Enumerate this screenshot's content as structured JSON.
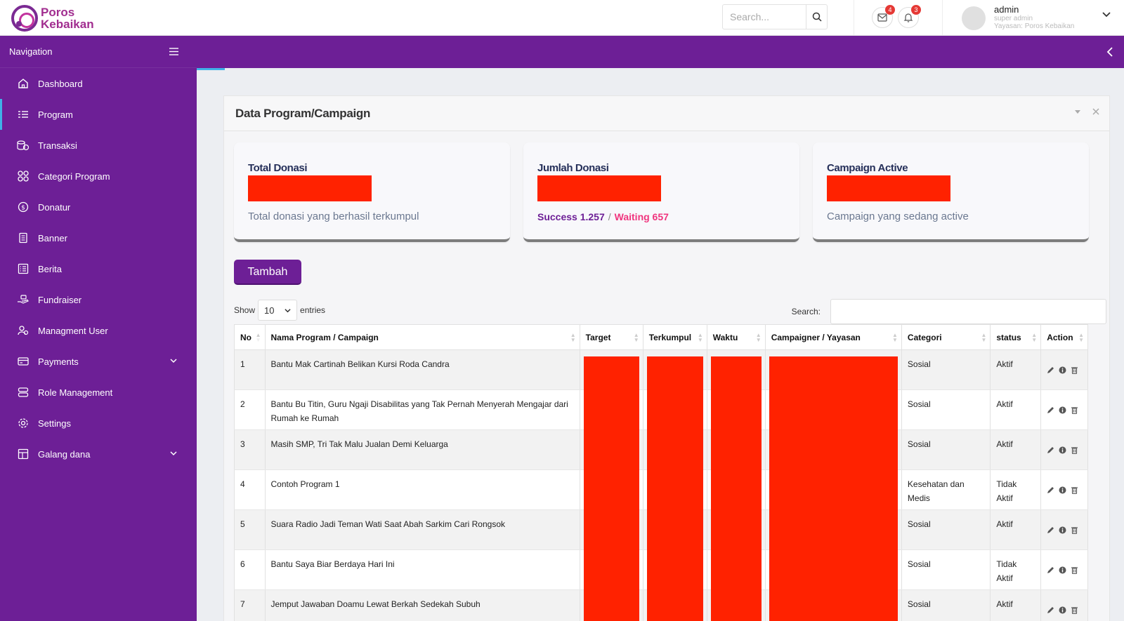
{
  "brand": {
    "line1": "Poros",
    "line2": "Kebaikan"
  },
  "search": {
    "placeholder": "Search..."
  },
  "notifications": {
    "mail_count": "4",
    "bell_count": "3"
  },
  "user": {
    "name": "admin",
    "role": "super admin",
    "org": "Yayasan: Poros Kebaikan"
  },
  "sidebar": {
    "heading": "Navigation",
    "items": [
      {
        "label": "Dashboard",
        "icon": "home-icon"
      },
      {
        "label": "Program",
        "icon": "list-icon"
      },
      {
        "label": "Transaksi",
        "icon": "coins-icon"
      },
      {
        "label": "Categori Program",
        "icon": "grid-icon"
      },
      {
        "label": "Donatur",
        "icon": "dollar-icon"
      },
      {
        "label": "Banner",
        "icon": "document-icon"
      },
      {
        "label": "Berita",
        "icon": "news-icon"
      },
      {
        "label": "Fundraiser",
        "icon": "hand-icon"
      },
      {
        "label": "Managment User",
        "icon": "users-icon"
      },
      {
        "label": "Payments",
        "icon": "card-icon"
      },
      {
        "label": "Role Management",
        "icon": "database-icon"
      },
      {
        "label": "Settings",
        "icon": "gear-icon"
      },
      {
        "label": "Galang dana",
        "icon": "layout-icon"
      }
    ]
  },
  "panel": {
    "title": "Data Program/Campaign"
  },
  "cards": {
    "total": {
      "title": "Total Donasi",
      "sub": "Total donasi yang berhasil terkumpul"
    },
    "jumlah": {
      "title": "Jumlah Donasi",
      "success": "Success 1.257",
      "slash": "/",
      "waiting": "Waiting 657"
    },
    "active": {
      "title": "Campaign Active",
      "sub": "Campaign yang sedang active"
    }
  },
  "add_button": "Tambah",
  "table_controls": {
    "show": "Show",
    "page_size": "10",
    "entries": "entries",
    "search_label": "Search:"
  },
  "table": {
    "headers": [
      "No",
      "Nama Program / Campaign",
      "Target",
      "Terkumpul",
      "Waktu",
      "Campaigner / Yayasan",
      "Categori",
      "status",
      "Action"
    ],
    "rows": [
      {
        "no": "1",
        "name": "Bantu Mak Cartinah Belikan Kursi Roda Candra",
        "category": "Sosial",
        "status": "Aktif"
      },
      {
        "no": "2",
        "name": "Bantu Bu Titin, Guru Ngaji Disabilitas yang Tak Pernah Menyerah Mengajar dari Rumah ke Rumah",
        "category": "Sosial",
        "status": "Aktif"
      },
      {
        "no": "3",
        "name": "Masih SMP, Tri Tak Malu Jualan Demi Keluarga",
        "category": "Sosial",
        "status": "Aktif"
      },
      {
        "no": "4",
        "name": "Contoh Program 1",
        "category": "Kesehatan dan Medis",
        "status": "Tidak Aktif"
      },
      {
        "no": "5",
        "name": "Suara Radio Jadi Teman Wati Saat Abah Sarkim Cari Rongsok",
        "category": "Sosial",
        "status": "Aktif"
      },
      {
        "no": "6",
        "name": "Bantu Saya Biar Berdaya Hari Ini",
        "category": "Sosial",
        "status": "Tidak Aktif"
      },
      {
        "no": "7",
        "name": "Jemput Jawaban Doamu Lewat Berkah Sedekah Subuh",
        "category": "Sosial",
        "status": "Aktif"
      }
    ]
  }
}
